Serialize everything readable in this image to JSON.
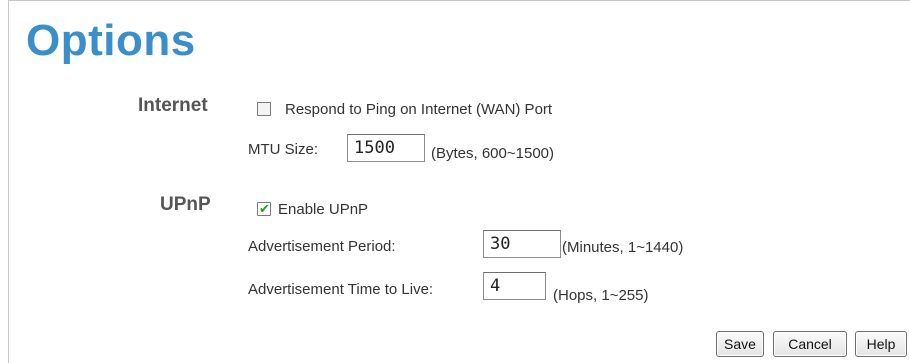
{
  "page": {
    "title": "Options"
  },
  "internet": {
    "section_label": "Internet",
    "ping_checkbox_label": "Respond to Ping on Internet (WAN) Port",
    "ping_checked": false,
    "mtu_label": "MTU Size:",
    "mtu_value": "1500",
    "mtu_hint": "(Bytes, 600~1500)"
  },
  "upnp": {
    "section_label": "UPnP",
    "enable_label": "Enable UPnP",
    "enable_checked": true,
    "adv_period_label": "Advertisement Period:",
    "adv_period_value": "30",
    "adv_period_hint": "(Minutes, 1~1440)",
    "adv_ttl_label": "Advertisement Time to Live:",
    "adv_ttl_value": "4",
    "adv_ttl_hint": "(Hops, 1~255)"
  },
  "buttons": {
    "save": "Save",
    "cancel": "Cancel",
    "help": "Help"
  }
}
